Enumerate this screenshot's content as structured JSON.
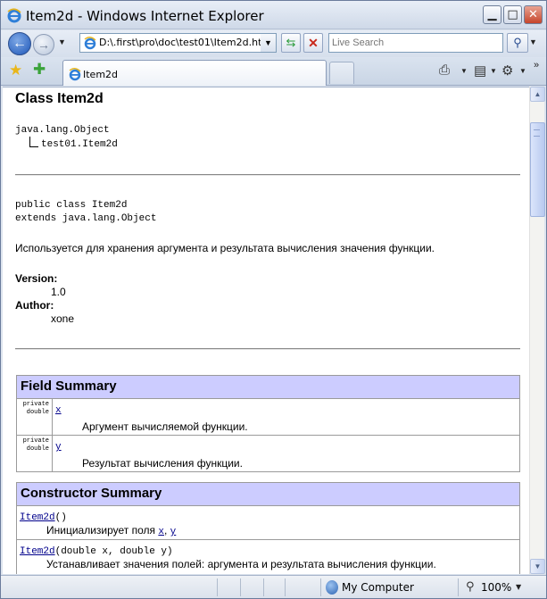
{
  "window": {
    "title": "Item2d - Windows Internet Explorer"
  },
  "icons": {
    "ie": "ie-logo-icon",
    "back": "back-arrow-icon",
    "forward": "forward-arrow-icon",
    "refresh": "refresh-icon",
    "stop": "stop-icon",
    "search": "search-icon",
    "favorites": "favorites-star-icon",
    "add_favorites": "add-favorites-icon",
    "print": "print-icon",
    "page": "page-icon",
    "tools": "tools-gear-icon",
    "zone": "globe-icon",
    "zoom": "zoom-icon"
  },
  "address": {
    "url": "D:\\.first\\pro\\doc\\test01\\Item2d.html"
  },
  "search": {
    "placeholder": "Live Search"
  },
  "tab": {
    "label": "Item2d"
  },
  "page": {
    "title": "Class Item2d",
    "hierarchy_root": "java.lang.Object",
    "hierarchy_child": "test01.Item2d",
    "decl_line1": "public class Item2d",
    "decl_line2": "extends java.lang.Object",
    "description": "Используется для хранения аргумента и результата вычисления значения функции.",
    "version_label": "Version:",
    "version_value": "1.0",
    "author_label": "Author:",
    "author_value": "xone",
    "field_summary_title": "Field Summary",
    "fields": [
      {
        "modifier_1": "private",
        "modifier_2": "double",
        "name": "x",
        "desc": "Аргумент вычисляемой функции."
      },
      {
        "modifier_1": "private",
        "modifier_2": "double",
        "name": "y",
        "desc": "Результат вычисления функции."
      }
    ],
    "constructor_summary_title": "Constructor Summary",
    "constructors": [
      {
        "name": "Item2d",
        "params": "()",
        "desc_prefix": "Инициализирует поля ",
        "link1": "x",
        "sep": ", ",
        "link2": "y"
      },
      {
        "name": "Item2d",
        "params": "(double x, double y)",
        "desc": "Устанавливает значения полей: аргумента и результата вычисления функции."
      }
    ]
  },
  "status": {
    "zone": "My Computer",
    "zoom": "100%"
  },
  "colors": {
    "table_header_bg": "#ccccff",
    "link": "#00008b"
  }
}
